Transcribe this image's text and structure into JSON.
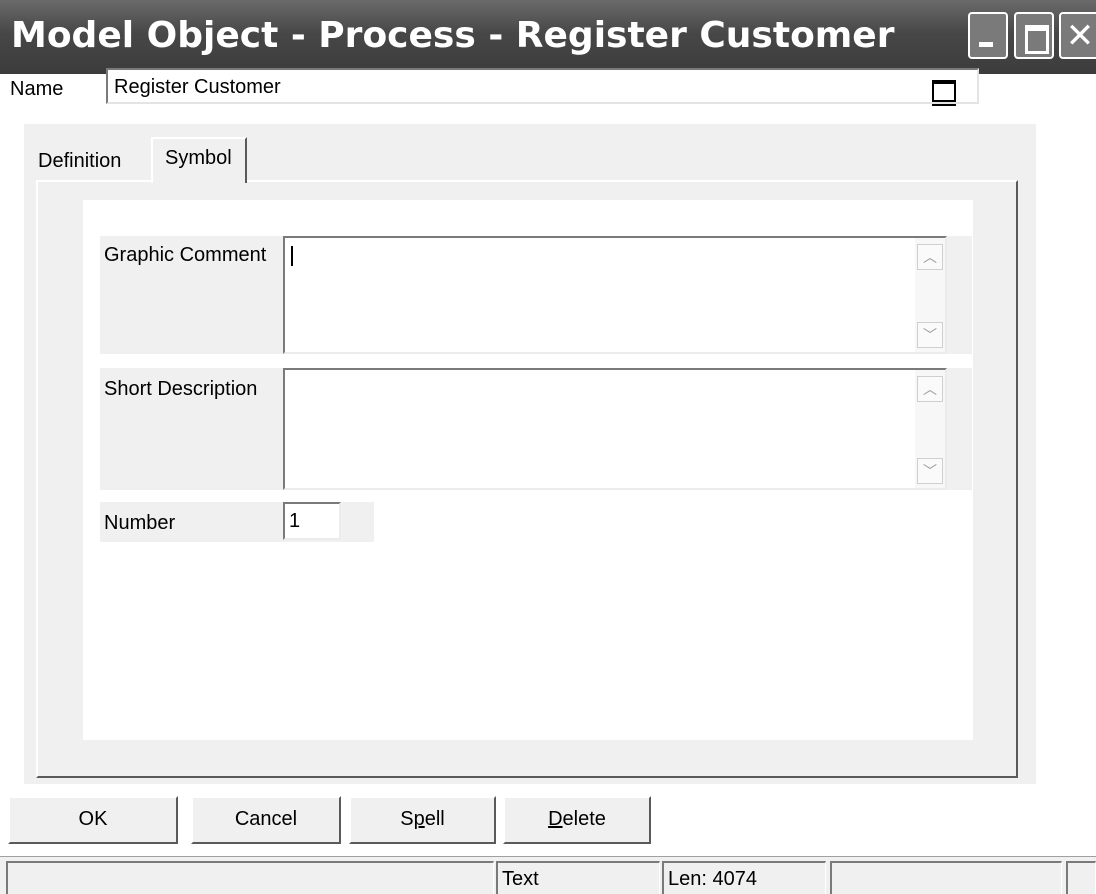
{
  "window": {
    "title": "Model Object - Process - Register Customer"
  },
  "name_field": {
    "label": "Name",
    "value": "Register Customer"
  },
  "tabs": [
    {
      "label": "Definition",
      "active": false
    },
    {
      "label": "Symbol",
      "active": true
    }
  ],
  "fields": {
    "graphic_comment": {
      "label": "Graphic Comment",
      "value": ""
    },
    "short_description": {
      "label": "Short Description",
      "value": ""
    },
    "number": {
      "label": "Number",
      "value": "1"
    }
  },
  "buttons": {
    "ok": {
      "label": "OK"
    },
    "cancel": {
      "label": "Cancel"
    },
    "spell": {
      "label_pre": "S",
      "accel": "p",
      "label_post": "ell"
    },
    "delete": {
      "label_pre": "",
      "accel": "D",
      "label_post": "elete"
    }
  },
  "status": {
    "mode": "Text",
    "length": "Len: 4074"
  },
  "icons": [
    "minimize-icon",
    "maximize-icon",
    "close-icon",
    "expand-icon",
    "scroll-up-icon",
    "scroll-down-icon"
  ],
  "colors": {
    "titlebar": "#474747",
    "dialog": "#f0f0f0",
    "content": "#ffffff"
  }
}
